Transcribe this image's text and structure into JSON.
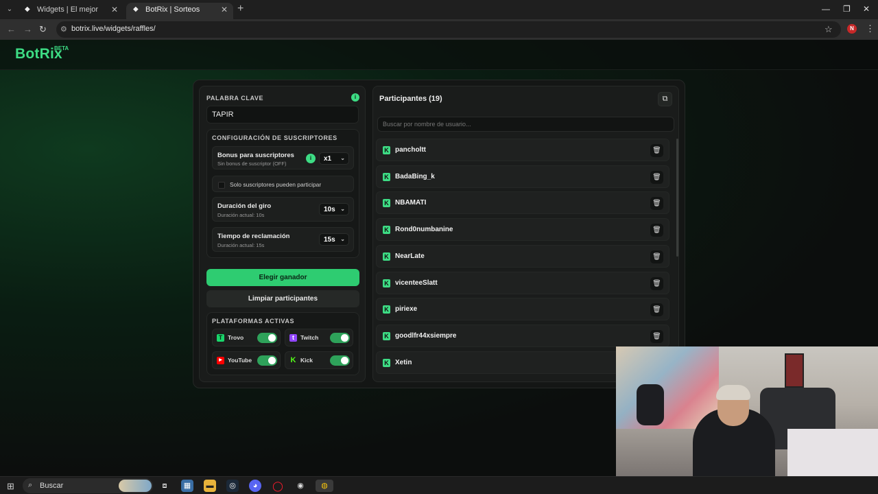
{
  "browser": {
    "tabs": [
      {
        "title": "Widgets | El mejor software pa",
        "close": "✕"
      },
      {
        "title": "BotRix | Sorteos",
        "close": "✕"
      }
    ],
    "new_tab": "+",
    "url": "botrix.live/widgets/raffles/",
    "profile_initial": "N",
    "window_controls": {
      "minimize": "—",
      "restore": "❐",
      "close": "✕"
    }
  },
  "site": {
    "logo": "BotRix",
    "badge": "BETA"
  },
  "settings": {
    "keyword_label": "PALABRA CLAVE",
    "keyword_value": "TAPIR",
    "subs_section_label": "CONFIGURACIÓN DE SUSCRIPTORES",
    "bonus": {
      "title": "Bonus para suscriptores",
      "subtitle": "Sin bonus de suscriptor (OFF)",
      "value": "x1"
    },
    "subs_only_label": "Solo suscriptores pueden participar",
    "subs_only_checked": false,
    "spin": {
      "title": "Duración del giro",
      "subtitle": "Duración actual: 10s",
      "value": "10s"
    },
    "claim": {
      "title": "Tiempo de reclamación",
      "subtitle": "Duración actual: 15s",
      "value": "15s"
    },
    "pick_winner": "Elegir ganador",
    "clear_participants": "Limpiar participantes",
    "platforms_label": "PLATAFORMAS ACTIVAS",
    "platforms": [
      {
        "name": "Trovo",
        "enabled": true,
        "color": "#19d66b"
      },
      {
        "name": "Twitch",
        "enabled": true,
        "color": "#9146ff"
      },
      {
        "name": "YouTube",
        "enabled": true,
        "color": "#ff0000"
      },
      {
        "name": "Kick",
        "enabled": true,
        "color": "#53fc18"
      }
    ]
  },
  "participants": {
    "title": "Participantes (19)",
    "search_placeholder": "Buscar por nombre de usuario...",
    "list": [
      "pancholtt",
      "BadaBing_k",
      "NBAMATI",
      "Rond0numbanine",
      "NearLate",
      "vicenteeSlatt",
      "piriexe",
      "goodlfr44xsiempre",
      "Xetin"
    ]
  },
  "taskbar": {
    "search_text": "Buscar"
  },
  "colors": {
    "accent": "#3ddc84",
    "primary_button": "#2ecc71",
    "toggle_on": "#2ea25a"
  }
}
